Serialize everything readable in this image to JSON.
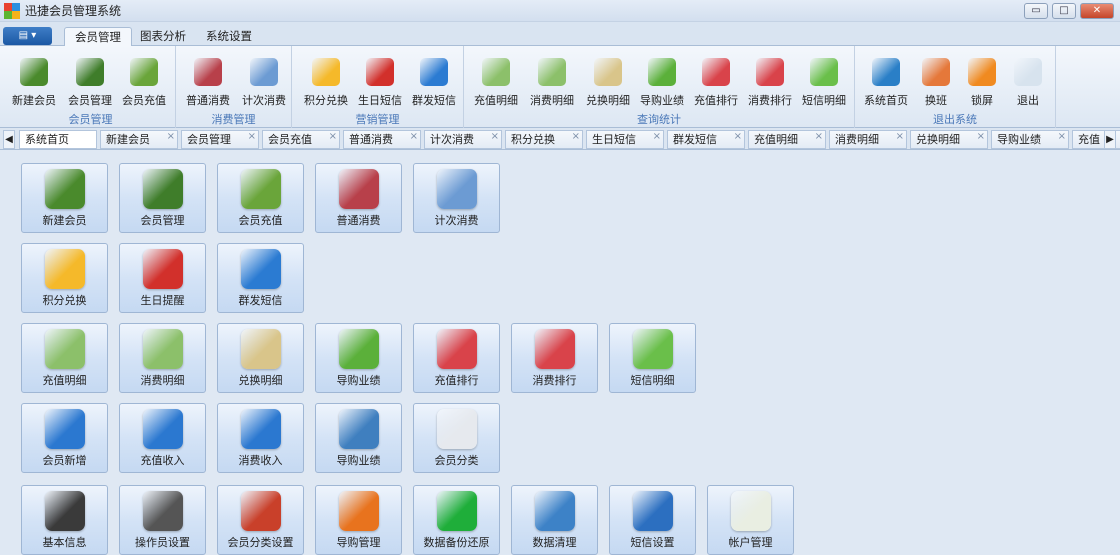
{
  "window": {
    "title": "迅捷会员管理系统",
    "minimize": "▭",
    "restore": "□",
    "close": "✕"
  },
  "app_menu": {
    "label": "▤ ▾"
  },
  "ribbon_tabs": [
    {
      "label": "会员管理",
      "active": true
    },
    {
      "label": "图表分析"
    },
    {
      "label": "系统设置"
    }
  ],
  "ribbon_groups": [
    {
      "label": "会员管理",
      "buttons": [
        {
          "label": "新建会员",
          "icon": "green-book-contact-icon",
          "color": "#4a8a2c"
        },
        {
          "label": "会员管理",
          "icon": "green-book-aa-icon",
          "color": "#3f7d2a"
        },
        {
          "label": "会员充值",
          "icon": "water-drop-icon",
          "color": "#6aa53a"
        }
      ]
    },
    {
      "label": "消费管理",
      "buttons": [
        {
          "label": "普通消费",
          "icon": "cash-register-icon",
          "color": "#b8404a"
        },
        {
          "label": "计次消费",
          "icon": "calendar-plus-one-icon",
          "color": "#6c9bd3"
        }
      ]
    },
    {
      "label": "营销管理",
      "buttons": [
        {
          "label": "积分兑换",
          "icon": "honeycomb-icon",
          "color": "#f5b92a"
        },
        {
          "label": "生日短信",
          "icon": "sms-red-icon",
          "color": "#d2302b"
        },
        {
          "label": "群发短信",
          "icon": "sms-blue-icon",
          "color": "#2b7bd2"
        }
      ]
    },
    {
      "label": "查询统计",
      "buttons": [
        {
          "label": "充值明细",
          "icon": "ledger-icon",
          "color": "#8cc06a"
        },
        {
          "label": "消费明细",
          "icon": "ledger-icon",
          "color": "#8cc06a"
        },
        {
          "label": "兑换明细",
          "icon": "coins-receipt-icon",
          "color": "#d9c58a"
        },
        {
          "label": "导购业绩",
          "icon": "growth-chart-icon",
          "color": "#5bb03a"
        },
        {
          "label": "充值排行",
          "icon": "bar-chart-icon",
          "color": "#d9434a"
        },
        {
          "label": "消费排行",
          "icon": "bar-chart-icon",
          "color": "#d9434a"
        },
        {
          "label": "短信明细",
          "icon": "message-note-icon",
          "color": "#6abf4a"
        }
      ]
    },
    {
      "label": "退出系统",
      "buttons": [
        {
          "label": "系统首页",
          "icon": "compass-icon",
          "color": "#2a7fc7"
        },
        {
          "label": "换班",
          "icon": "swap-icon",
          "color": "#e5783a"
        },
        {
          "label": "锁屏",
          "icon": "lock-icon",
          "color": "#f08a20"
        },
        {
          "label": "退出",
          "icon": "power-icon",
          "color": "#d7e3ee"
        }
      ]
    }
  ],
  "doc_tabs": [
    {
      "label": "系统首页",
      "active": true
    },
    {
      "label": "新建会员"
    },
    {
      "label": "会员管理"
    },
    {
      "label": "会员充值"
    },
    {
      "label": "普通消费"
    },
    {
      "label": "计次消费"
    },
    {
      "label": "积分兑换"
    },
    {
      "label": "生日短信"
    },
    {
      "label": "群发短信"
    },
    {
      "label": "充值明细"
    },
    {
      "label": "消费明细"
    },
    {
      "label": "兑换明细"
    },
    {
      "label": "导购业绩"
    },
    {
      "label": "充值"
    }
  ],
  "doc_tab_close": "×",
  "nav": {
    "left": "◀",
    "right": "▶"
  },
  "tiles": [
    [
      {
        "label": "新建会员",
        "icon": "green-book-contact-icon",
        "color": "#4a8a2c"
      },
      {
        "label": "会员管理",
        "icon": "green-book-aa-icon",
        "color": "#3f7d2a"
      },
      {
        "label": "会员充值",
        "icon": "water-drop-icon",
        "color": "#6aa53a"
      },
      {
        "label": "普通消费",
        "icon": "cash-register-icon",
        "color": "#b8404a"
      },
      {
        "label": "计次消费",
        "icon": "calendar-plus-one-icon",
        "color": "#6c9bd3"
      }
    ],
    [
      {
        "label": "积分兑换",
        "icon": "honeycomb-icon",
        "color": "#f5b92a"
      },
      {
        "label": "生日提醒",
        "icon": "sms-red-icon",
        "color": "#d2302b"
      },
      {
        "label": "群发短信",
        "icon": "sms-blue-icon",
        "color": "#2b7bd2"
      }
    ],
    [
      {
        "label": "充值明细",
        "icon": "ledger-icon",
        "color": "#8cc06a"
      },
      {
        "label": "消费明细",
        "icon": "ledger-icon",
        "color": "#8cc06a"
      },
      {
        "label": "兑换明细",
        "icon": "coins-receipt-icon",
        "color": "#d9c58a"
      },
      {
        "label": "导购业绩",
        "icon": "growth-chart-icon",
        "color": "#5bb03a"
      },
      {
        "label": "充值排行",
        "icon": "bar-chart-icon",
        "color": "#d9434a"
      },
      {
        "label": "消费排行",
        "icon": "bar-chart-icon",
        "color": "#d9434a"
      },
      {
        "label": "短信明细",
        "icon": "message-note-icon",
        "color": "#6abf4a"
      }
    ],
    [
      {
        "label": "会员新增",
        "icon": "bar-chart-blue-icon",
        "color": "#2b78d0"
      },
      {
        "label": "充值收入",
        "icon": "bar-chart-blue-icon",
        "color": "#2b78d0"
      },
      {
        "label": "消费收入",
        "icon": "bar-chart-blue-icon",
        "color": "#2b78d0"
      },
      {
        "label": "导购业绩",
        "icon": "waveform-icon",
        "color": "#3f7fbf"
      },
      {
        "label": "会员分类",
        "icon": "pie-chart-icon",
        "color": "#e6e9ee"
      }
    ],
    [
      {
        "label": "基本信息",
        "icon": "gear-icon",
        "color": "#3a3a3a"
      },
      {
        "label": "操作员设置",
        "icon": "joystick-icon",
        "color": "#555"
      },
      {
        "label": "会员分类设置",
        "icon": "puzzle-icon",
        "color": "#c9402a"
      },
      {
        "label": "导购管理",
        "icon": "org-chart-icon",
        "color": "#e8731e"
      },
      {
        "label": "数据备份还原",
        "icon": "backup-icon",
        "color": "#1fae3a"
      },
      {
        "label": "数据清理",
        "icon": "recycle-icon",
        "color": "#3d82c7"
      },
      {
        "label": "短信设置",
        "icon": "mail-icon",
        "color": "#2c6fc0"
      },
      {
        "label": "帐户管理",
        "icon": "umbrella-icon",
        "color": "#e9eee2"
      }
    ]
  ]
}
